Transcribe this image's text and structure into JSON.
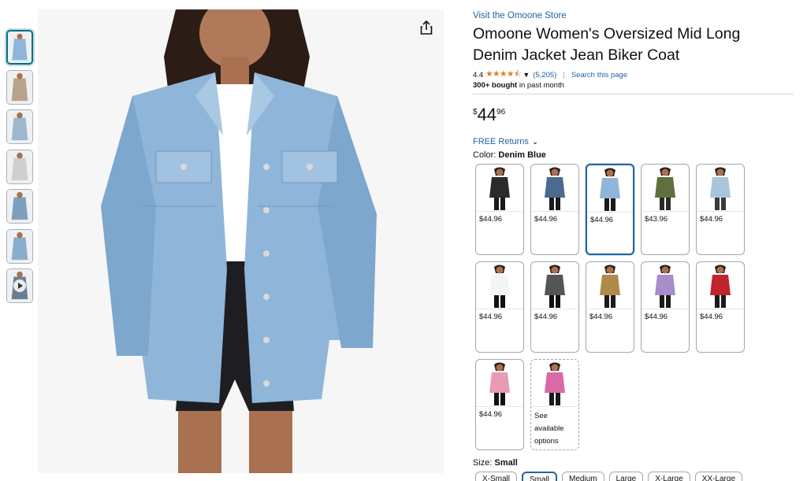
{
  "thumbnails": [
    {
      "name": "thumb-1",
      "color": "#8fb6d8",
      "active": true
    },
    {
      "name": "thumb-2",
      "color": "#b7a48a",
      "active": false
    },
    {
      "name": "thumb-3",
      "color": "#9db8cf",
      "active": false
    },
    {
      "name": "thumb-4",
      "color": "#cfcfcf",
      "active": false
    },
    {
      "name": "thumb-5",
      "color": "#7f9fbf",
      "active": false
    },
    {
      "name": "thumb-6",
      "color": "#89aecd",
      "active": false
    },
    {
      "name": "thumb-7",
      "color": "#6a7f93",
      "active": false,
      "video": true
    }
  ],
  "product": {
    "store_link": "Visit the Omoone Store",
    "title": "Omoone Women's Oversized Mid Long Denim Jacket Jean Biker Coat",
    "rating": "4.4",
    "stars": "★★★★⯪",
    "rating_count": "(5,205)",
    "separator": "|",
    "search_page": "Search this page",
    "bought_bold": "300+ bought",
    "bought_rest": " in past month",
    "price_symbol": "$",
    "price_whole": "44",
    "price_fraction": "96",
    "free_returns": "FREE Returns",
    "color_prefix": "Color: ",
    "color_name": "Denim Blue"
  },
  "colors": {
    "accent_link": "#2162a1",
    "star": "#de7921",
    "selected_border": "#2162a1"
  },
  "swatches": [
    {
      "price": "$44.96",
      "jacket": "#2b2b2b",
      "pants": "#1a1a1a",
      "selected": false
    },
    {
      "price": "$44.96",
      "jacket": "#4a6b8f",
      "pants": "#1a1a1a",
      "selected": false
    },
    {
      "price": "$44.96",
      "jacket": "#8fb6d8",
      "pants": "#1a1a1a",
      "selected": true
    },
    {
      "price": "$43.96",
      "jacket": "#5f6f3f",
      "pants": "#2a2a2a",
      "selected": false
    },
    {
      "price": "$44.96",
      "jacket": "#a9c4dd",
      "pants": "#3a3a3a",
      "selected": false
    },
    {
      "price": "$44.96",
      "jacket": "#f4f4f4",
      "pants": "#111111",
      "selected": false
    },
    {
      "price": "$44.96",
      "jacket": "#555555",
      "pants": "#111111",
      "selected": false
    },
    {
      "price": "$44.96",
      "jacket": "#b08a4a",
      "pants": "#1a1a1a",
      "selected": false
    },
    {
      "price": "$44.96",
      "jacket": "#a88ccc",
      "pants": "#1a1a1a",
      "selected": false
    },
    {
      "price": "$44.96",
      "jacket": "#c0242c",
      "pants": "#1a1a1a",
      "selected": false
    },
    {
      "price": "$44.96",
      "jacket": "#e99bb6",
      "pants": "#111111",
      "selected": false
    },
    {
      "see": "See available options",
      "jacket": "#d96aa5",
      "pants": "#1a1a1a",
      "selected": false
    }
  ],
  "size": {
    "prefix": "Size: ",
    "value": "Small",
    "options": [
      "X-Small",
      "Small",
      "Medium",
      "Large",
      "X-Large",
      "XX-Large"
    ],
    "selected_index": 1
  }
}
